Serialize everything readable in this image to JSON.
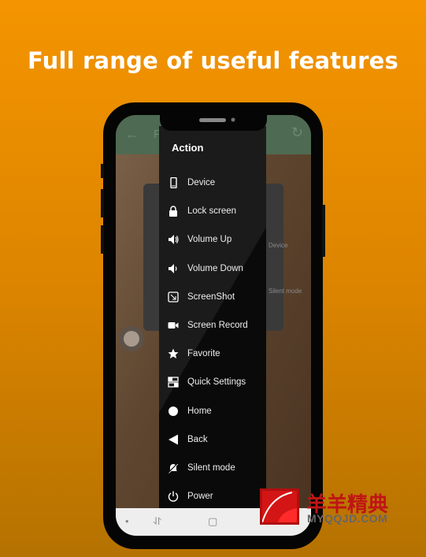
{
  "headline": "Full range of useful features",
  "app_header": {
    "back_icon": "arrow-left-icon",
    "title_fragment": "F",
    "refresh_icon": "refresh-icon"
  },
  "background_dialog": {
    "labels": [
      "Device",
      "Silent mode"
    ]
  },
  "menu": {
    "title": "Action",
    "items": [
      {
        "label": "Device",
        "icon": "phone-icon"
      },
      {
        "label": "Lock screen",
        "icon": "lock-icon"
      },
      {
        "label": "Volume Up",
        "icon": "volume-up-icon"
      },
      {
        "label": "Volume Down",
        "icon": "volume-down-icon"
      },
      {
        "label": "ScreenShot",
        "icon": "screenshot-icon"
      },
      {
        "label": "Screen Record",
        "icon": "video-camera-icon"
      },
      {
        "label": "Favorite",
        "icon": "star-icon"
      },
      {
        "label": "Quick Settings",
        "icon": "quick-settings-icon"
      },
      {
        "label": "Home",
        "icon": "circle-icon"
      },
      {
        "label": "Back",
        "icon": "triangle-left-icon"
      },
      {
        "label": "Silent mode",
        "icon": "bell-off-icon"
      },
      {
        "label": "Power",
        "icon": "power-icon"
      }
    ]
  },
  "navbar": {
    "dot": "•",
    "recents": "⥯",
    "home": "▢",
    "back": "‹"
  },
  "watermark": {
    "title": "羊羊精典",
    "url": "MYQQJD.COM"
  },
  "colors": {
    "background_top": "#f49400",
    "background_bottom": "#b57200",
    "header": "#4f6a52",
    "menu": "#0a0a0a"
  }
}
